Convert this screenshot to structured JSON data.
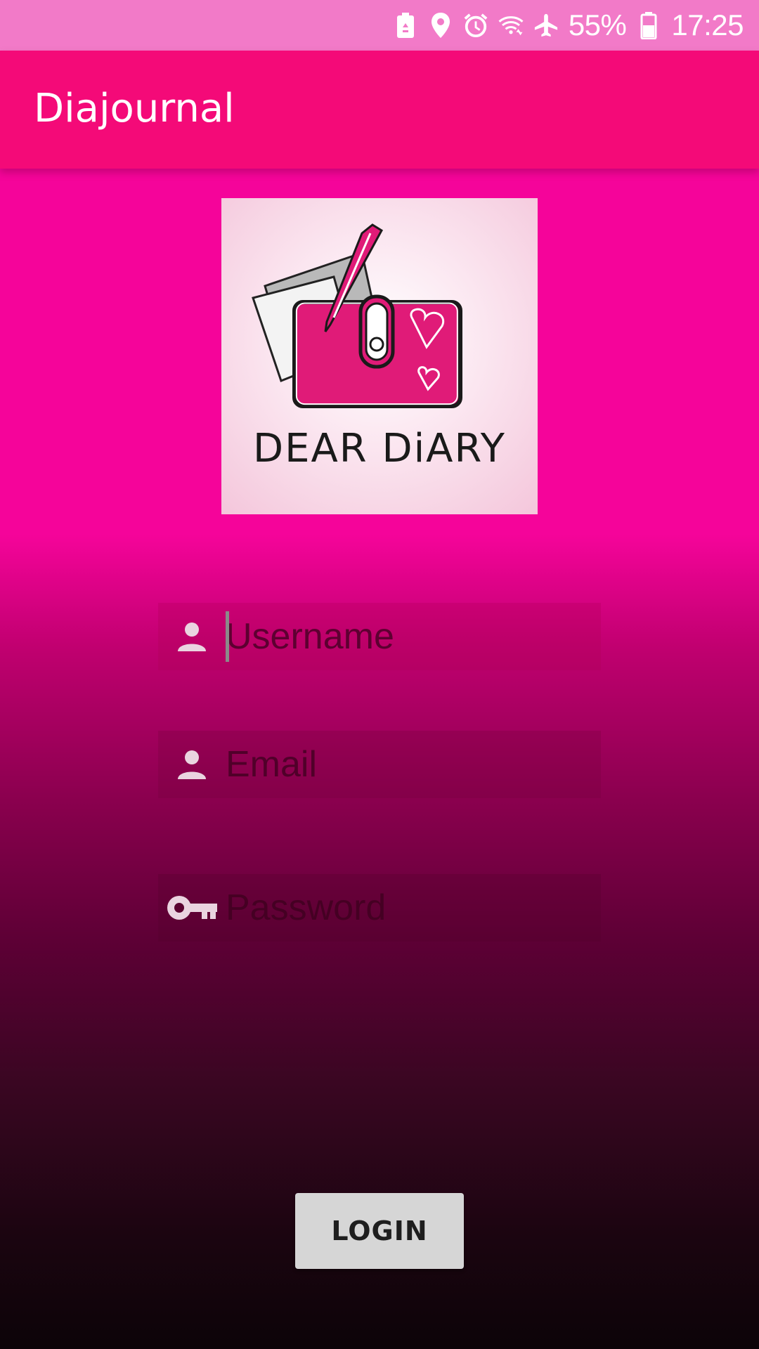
{
  "status_bar": {
    "battery_percent": "55%",
    "time": "17:25",
    "icons": [
      "battery-saver-icon",
      "location-icon",
      "alarm-icon",
      "wifi-icon",
      "airplane-mode-icon",
      "battery-icon"
    ]
  },
  "app_bar": {
    "title": "Diajournal",
    "color": "#f40a78"
  },
  "logo": {
    "icon": "dear-diary-logo",
    "text": "DEAR DiARY"
  },
  "form": {
    "username": {
      "placeholder": "Username",
      "value": "",
      "icon": "person-icon"
    },
    "email": {
      "placeholder": "Email",
      "value": "",
      "icon": "person-icon"
    },
    "password": {
      "placeholder": "Password",
      "value": "",
      "icon": "key-icon"
    }
  },
  "login_button": {
    "label": "LOGIN"
  },
  "colors": {
    "status_bar": "#f27ac8",
    "background_top": "#f5049a",
    "background_bottom": "#0c0408",
    "button": "#d6d6d6"
  }
}
